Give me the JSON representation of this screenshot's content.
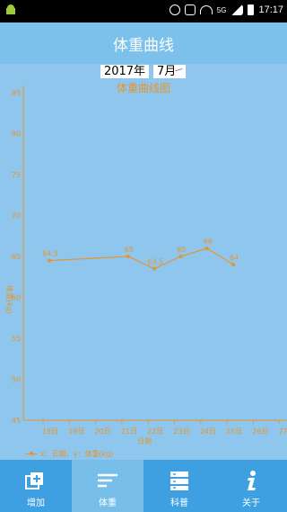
{
  "status_bar": {
    "time": "17:17",
    "signal_text": "5G"
  },
  "header": {
    "title": "体重曲线"
  },
  "date_selector": {
    "year": "2017年",
    "month": "7月"
  },
  "chart_data": {
    "type": "line",
    "title": "体重曲线图",
    "xlabel": "日期",
    "ylabel": "体重(kg)",
    "legend": "x：日期，y：体重(kg)",
    "x_ticks": [
      "18日",
      "19日",
      "20日",
      "21日",
      "22日",
      "23日",
      "24日",
      "25日",
      "26日",
      "27日"
    ],
    "y_ticks": [
      "45",
      "50",
      "55",
      "60",
      "65",
      "70",
      "75",
      "80",
      "85"
    ],
    "ylim": [
      45,
      85
    ],
    "series": [
      {
        "x": [
          "18日",
          "21日",
          "22日",
          "23日",
          "24日",
          "25日"
        ],
        "values": [
          64.5,
          65,
          63.5,
          65,
          66,
          64
        ],
        "labels": [
          "64.5",
          "65",
          "63.5",
          "65",
          "66",
          "64"
        ]
      }
    ],
    "color": "#e8942a"
  },
  "tabs": [
    {
      "label": "增加",
      "icon": "add-icon",
      "active": false
    },
    {
      "label": "体重",
      "icon": "weight-chart-icon",
      "active": true
    },
    {
      "label": "科普",
      "icon": "list-icon",
      "active": false
    },
    {
      "label": "关于",
      "icon": "info-icon",
      "active": false
    }
  ]
}
